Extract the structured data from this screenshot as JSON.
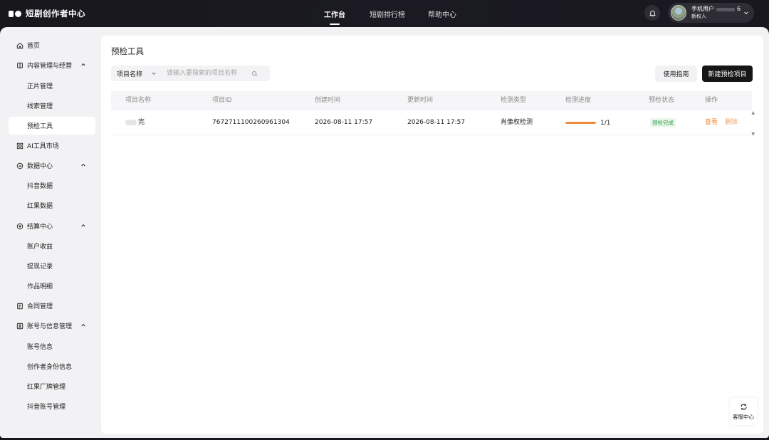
{
  "app": {
    "title": "短剧创作者中心"
  },
  "topnav": {
    "items": [
      {
        "label": "工作台",
        "active": true
      },
      {
        "label": "短剧排行榜",
        "active": false
      },
      {
        "label": "帮助中心",
        "active": false
      }
    ]
  },
  "user": {
    "name_prefix": "手机用户",
    "name_suffix": "6",
    "level": "新权人"
  },
  "sidebar": {
    "items": [
      {
        "label": "首页",
        "type": "group",
        "icon": "home-icon"
      },
      {
        "label": "内容管理与经营",
        "type": "group",
        "icon": "content-icon",
        "expanded": true
      },
      {
        "label": "正片管理",
        "type": "sub"
      },
      {
        "label": "线索管理",
        "type": "sub"
      },
      {
        "label": "预检工具",
        "type": "sub",
        "active": true
      },
      {
        "label": "AI工具市场",
        "type": "group",
        "icon": "grid-icon"
      },
      {
        "label": "数据中心",
        "type": "group",
        "icon": "chart-icon",
        "expanded": true
      },
      {
        "label": "抖音数据",
        "type": "sub"
      },
      {
        "label": "红果数据",
        "type": "sub"
      },
      {
        "label": "结算中心",
        "type": "group",
        "icon": "coin-icon",
        "expanded": true
      },
      {
        "label": "账户收益",
        "type": "sub"
      },
      {
        "label": "提现记录",
        "type": "sub"
      },
      {
        "label": "作品明细",
        "type": "sub"
      },
      {
        "label": "合同管理",
        "type": "group",
        "icon": "contract-icon"
      },
      {
        "label": "账号与信息管理",
        "type": "group",
        "icon": "user-icon",
        "expanded": true
      },
      {
        "label": "账号信息",
        "type": "sub"
      },
      {
        "label": "创作者身份信息",
        "type": "sub"
      },
      {
        "label": "红果厂牌管理",
        "type": "sub"
      },
      {
        "label": "抖音账号管理",
        "type": "sub"
      }
    ]
  },
  "main": {
    "title": "预检工具",
    "filter": {
      "field_label": "项目名称",
      "placeholder": "请输入要搜索的项目名称"
    },
    "buttons": {
      "guide": "使用指南",
      "new_project": "新建预检项目"
    },
    "table": {
      "headers": [
        "项目名称",
        "项目ID",
        "创建时间",
        "更新时间",
        "检测类型",
        "检测进度",
        "预检状态",
        "操作"
      ],
      "rows": [
        {
          "name": "完",
          "id": "7672711100260961304",
          "created": "2026-08-11 17:57",
          "updated": "2026-08-11 17:57",
          "check_type": "肖像权检测",
          "progress_fraction": 1.0,
          "progress_text": "1/1",
          "status": "预检完成",
          "actions": {
            "view": "查看",
            "delete": "删除"
          }
        }
      ]
    }
  },
  "service": {
    "label": "客服中心"
  },
  "colors": {
    "accent_orange": "#f28c3a",
    "status_green": "#2f9a48",
    "topbar_bg": "#17171c",
    "primary_button": "#161616"
  }
}
